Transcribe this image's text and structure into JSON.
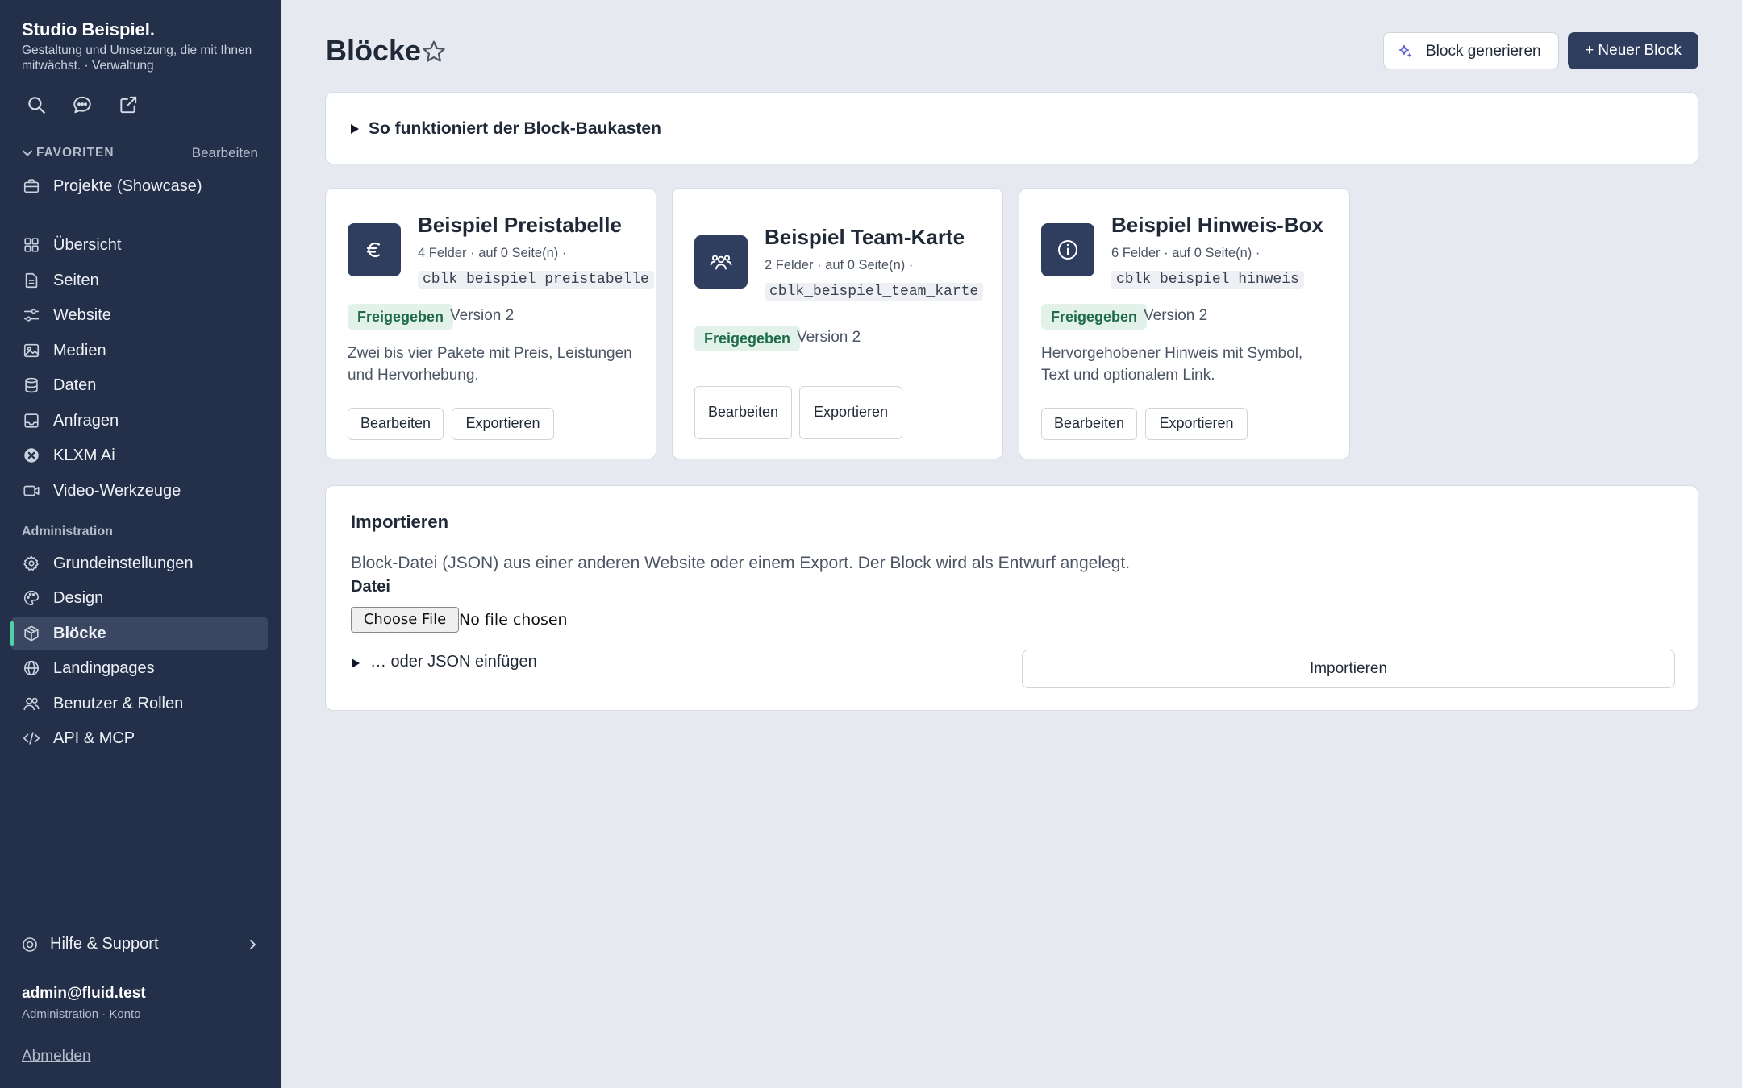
{
  "brand": {
    "name": "Studio Beispiel.",
    "subtitle": "Gestaltung und Umsetzung, die mit Ihnen mitwächst. · Verwaltung"
  },
  "toolbar_icons": [
    "search-icon",
    "chat-icon",
    "external-link-icon"
  ],
  "favorites": {
    "label": "FAVORITEN",
    "edit_label": "Bearbeiten",
    "items": [
      {
        "label": "Projekte (Showcase)",
        "icon": "briefcase-icon"
      }
    ]
  },
  "nav": {
    "main": [
      {
        "label": "Übersicht",
        "icon": "dashboard-icon"
      },
      {
        "label": "Seiten",
        "icon": "pages-icon"
      },
      {
        "label": "Website",
        "icon": "sliders-icon"
      },
      {
        "label": "Medien",
        "icon": "image-icon"
      },
      {
        "label": "Daten",
        "icon": "database-icon"
      },
      {
        "label": "Anfragen",
        "icon": "inbox-icon"
      },
      {
        "label": "KLXM Ai",
        "icon": "ai-icon"
      },
      {
        "label": "Video-Werkzeuge",
        "icon": "video-icon"
      }
    ],
    "admin_label": "Administration",
    "admin": [
      {
        "label": "Grundeinstellungen",
        "icon": "gear-icon"
      },
      {
        "label": "Design",
        "icon": "palette-icon"
      },
      {
        "label": "Blöcke",
        "icon": "cube-icon",
        "active": true
      },
      {
        "label": "Landingpages",
        "icon": "globe-icon"
      },
      {
        "label": "Benutzer & Rollen",
        "icon": "users-icon"
      },
      {
        "label": "API & MCP",
        "icon": "code-icon"
      }
    ]
  },
  "help": {
    "label": "Hilfe & Support"
  },
  "user": {
    "email": "admin@fluid.test",
    "role": "Administration · Konto",
    "logout": "Abmelden"
  },
  "header": {
    "title": "Blöcke",
    "generate_label": "Block generieren",
    "new_label": "+ Neuer Block"
  },
  "how_it_works": {
    "label": "So funktioniert der Block-Baukasten"
  },
  "blocks": [
    {
      "title": "Beispiel Preistabelle",
      "meta": "4 Felder · auf 0 Seite(n) ·",
      "code": "cblk_beispiel_preistabelle",
      "status": "Freigegeben",
      "version": "Version 2",
      "description": "Zwei bis vier Pakete mit Preis, Leistungen und Hervorhebung.",
      "icon": "euro-icon",
      "edit": "Bearbeiten",
      "export": "Exportieren"
    },
    {
      "title": "Beispiel Team-Karte",
      "meta": "2 Felder · auf 0 Seite(n) ·",
      "code": "cblk_beispiel_team_karte",
      "status": "Freigegeben",
      "version": "Version 2",
      "description": "",
      "icon": "team-icon",
      "edit": "Bearbeiten",
      "export": "Exportieren"
    },
    {
      "title": "Beispiel Hinweis-Box",
      "meta": "6 Felder · auf 0 Seite(n) ·",
      "code": "cblk_beispiel_hinweis",
      "status": "Freigegeben",
      "version": "Version 2",
      "description": "Hervorgehobener Hinweis mit Symbol, Text und optionalem Link.",
      "icon": "info-icon",
      "edit": "Bearbeiten",
      "export": "Exportieren"
    }
  ],
  "import": {
    "title": "Importieren",
    "description": "Block-Datei (JSON) aus einer anderen Website oder einem Export. Der Block wird als Entwurf angelegt.",
    "file_label": "Datei",
    "choose_label": "Choose File",
    "no_file": "No file chosen",
    "json_toggle": "… oder JSON einfügen",
    "button": "Importieren"
  }
}
